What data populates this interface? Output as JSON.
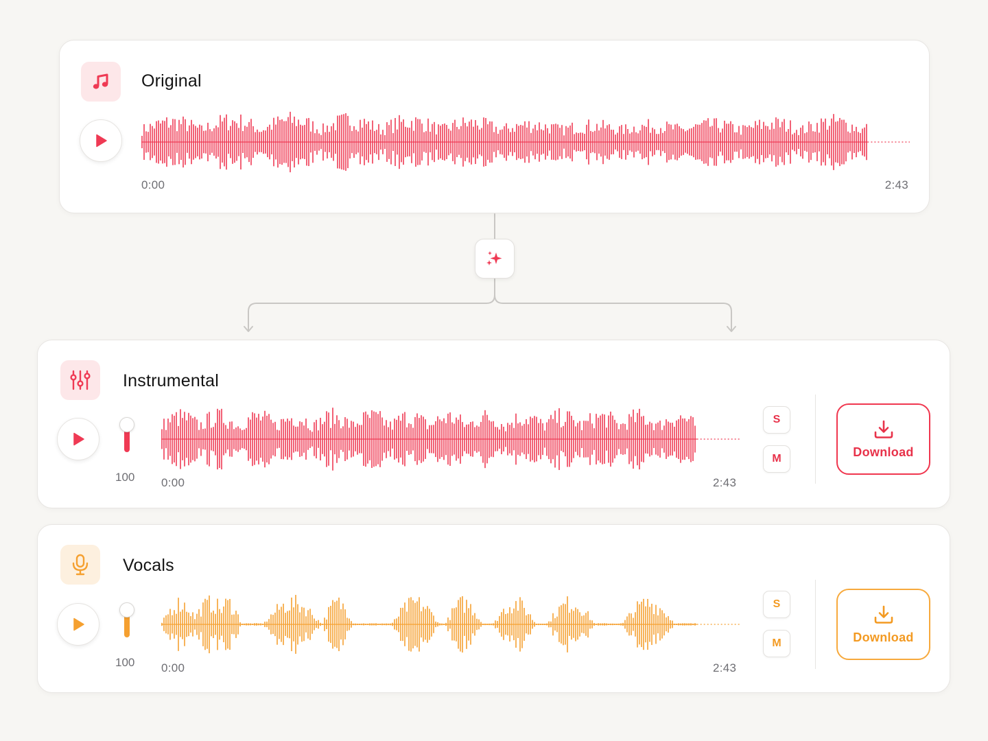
{
  "colors": {
    "accent_red": "#ef3a54",
    "accent_orange": "#f5a030",
    "background": "#f7f6f3"
  },
  "separate_node": {
    "icon": "sparkles-icon"
  },
  "original": {
    "icon": "music-note-icon",
    "title": "Original",
    "start_time": "0:00",
    "end_time": "2:43"
  },
  "instrumental": {
    "icon": "equalizer-sliders-icon",
    "title": "Instrumental",
    "start_time": "0:00",
    "end_time": "2:43",
    "volume": "100",
    "volume_level": 1.0,
    "solo_label": "S",
    "mute_label": "M",
    "download_label": "Download"
  },
  "vocals": {
    "icon": "microphone-icon",
    "title": "Vocals",
    "start_time": "0:00",
    "end_time": "2:43",
    "volume": "100",
    "volume_level": 1.0,
    "solo_label": "S",
    "mute_label": "M",
    "download_label": "Download"
  }
}
